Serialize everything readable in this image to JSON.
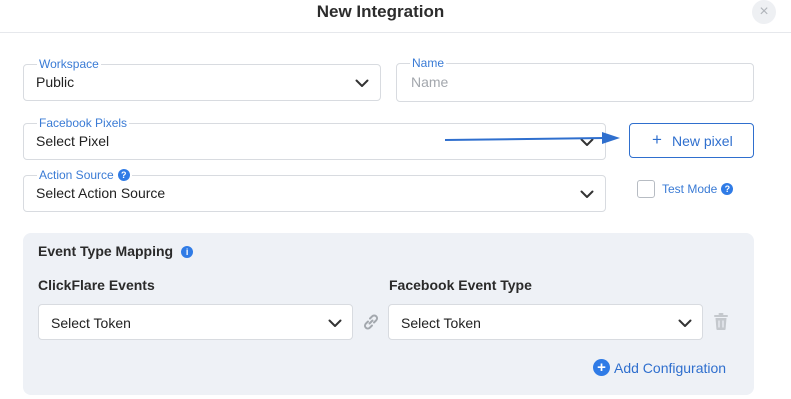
{
  "modal": {
    "title": "New Integration",
    "close_icon": "close-icon"
  },
  "workspace": {
    "label": "Workspace",
    "value": "Public"
  },
  "name": {
    "label": "Name",
    "placeholder": "Name"
  },
  "facebook_pixels": {
    "label": "Facebook Pixels",
    "value": "Select Pixel"
  },
  "new_pixel": {
    "label": "New pixel",
    "icon": "plus-icon"
  },
  "action_source": {
    "label": "Action Source",
    "value": "Select Action Source"
  },
  "test_mode": {
    "label": "Test Mode",
    "checked": false
  },
  "mapping": {
    "title": "Event Type Mapping",
    "clickflare_header": "ClickFlare Events",
    "facebook_header": "Facebook Event Type",
    "rows": [
      {
        "clickflare_value": "Select Token",
        "facebook_value": "Select Token"
      }
    ],
    "add_label": "Add Configuration"
  },
  "colors": {
    "accent": "#2f6fce",
    "label_blue": "#3a7bd5",
    "panel_bg": "#eef1f6",
    "border": "#d8dbe0"
  }
}
